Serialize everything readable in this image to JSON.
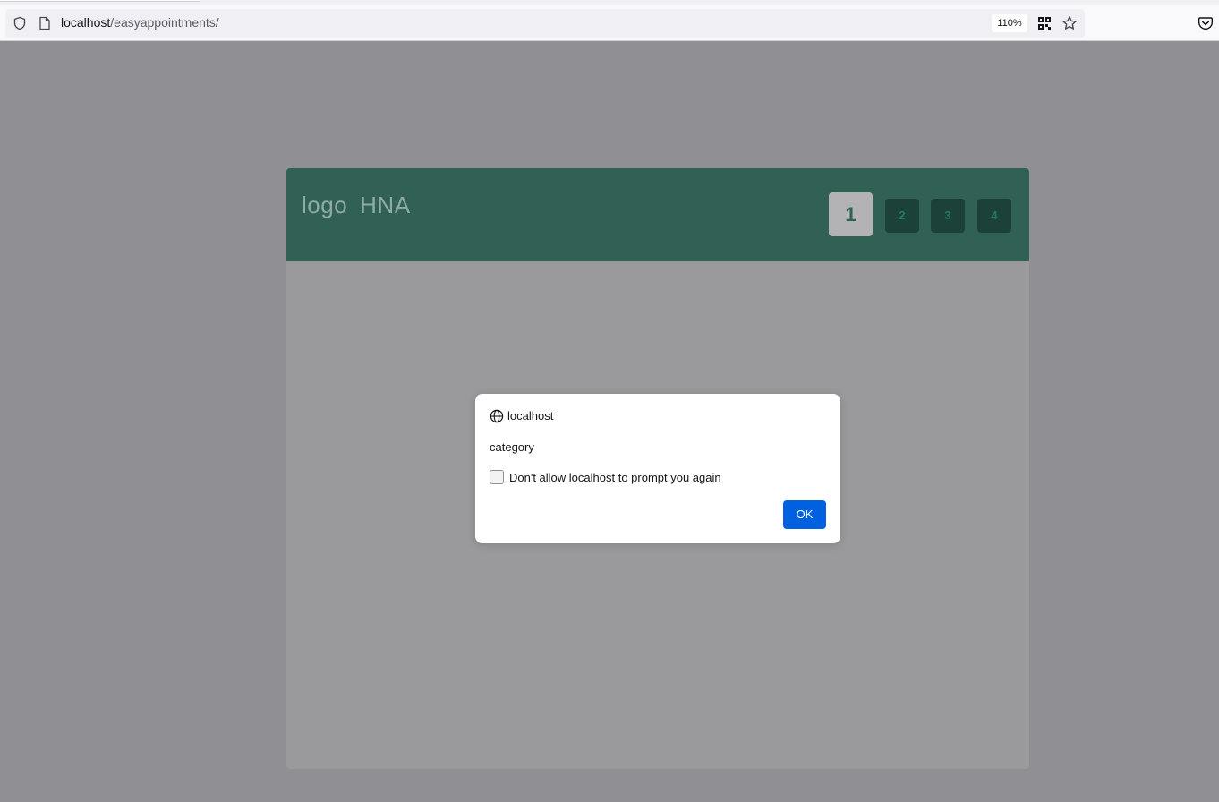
{
  "browser": {
    "url_host": "localhost",
    "url_path": "/easyappointments/",
    "zoom": "110%",
    "icons": [
      "shield-icon",
      "page-icon",
      "qr-code-icon",
      "bookmark-star-icon",
      "pocket-icon"
    ]
  },
  "wizard": {
    "logo": "logo",
    "brand": "HNA",
    "steps": [
      {
        "label": "1",
        "active": true
      },
      {
        "label": "2",
        "active": false
      },
      {
        "label": "3",
        "active": false
      },
      {
        "label": "4",
        "active": false
      }
    ],
    "colors": {
      "header": "#316155",
      "active_step": "#b3b3b5",
      "inactive_step": "#1c4139"
    }
  },
  "dialog": {
    "origin": "localhost",
    "message": "category",
    "checkbox_label": "Don't allow localhost to prompt you again",
    "checkbox_checked": false,
    "ok_label": "OK",
    "colors": {
      "ok_button": "#0061e0"
    }
  }
}
